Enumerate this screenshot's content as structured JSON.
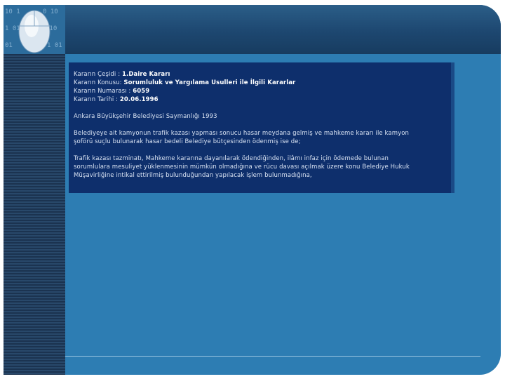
{
  "document": {
    "fields": [
      {
        "label": "Kararın Çeşidi :",
        "value": "1.Daire Kararı"
      },
      {
        "label": "Kararın Konusu:",
        "value": "Sorumluluk ve Yargılama Usulleri ile İlgili Kararlar"
      },
      {
        "label": "Kararın Numarası :",
        "value": "6059"
      },
      {
        "label": "Kararın Tarihi :",
        "value": "20.06.1996"
      }
    ],
    "institution": "Ankara Büyükşehir Belediyesi Saymanlığı 1993",
    "paragraph1": [
      "Belediyeye ait kamyonun trafik kazası yapması sonucu hasar meydana gelmiş ve mahkeme kararı ile kamyon",
      "şoförü suçlu bulunarak hasar bedeli Belediye bütçesinden ödenmiş ise de;"
    ],
    "paragraph2": [
      "Trafik kazası tazminatı, Mahkeme kararına dayanılarak ödendiğinden, ilâmı infaz için ödemede bulunan",
      "sorumlulara mesuliyet yüklenmesinin mümkün olmadığına ve rücu davası açılmak üzere konu Belediye Hukuk",
      "Müşavirliğine intikal ettirilmiş bulunduğundan yapılacak işlem bulunmadığına,"
    ]
  },
  "colors": {
    "slide_background": "#2d7db3",
    "content_box": "#0e2f6c",
    "header": "#1d4770"
  },
  "icons": {
    "logo": "computer-mouse-binary-icon"
  }
}
